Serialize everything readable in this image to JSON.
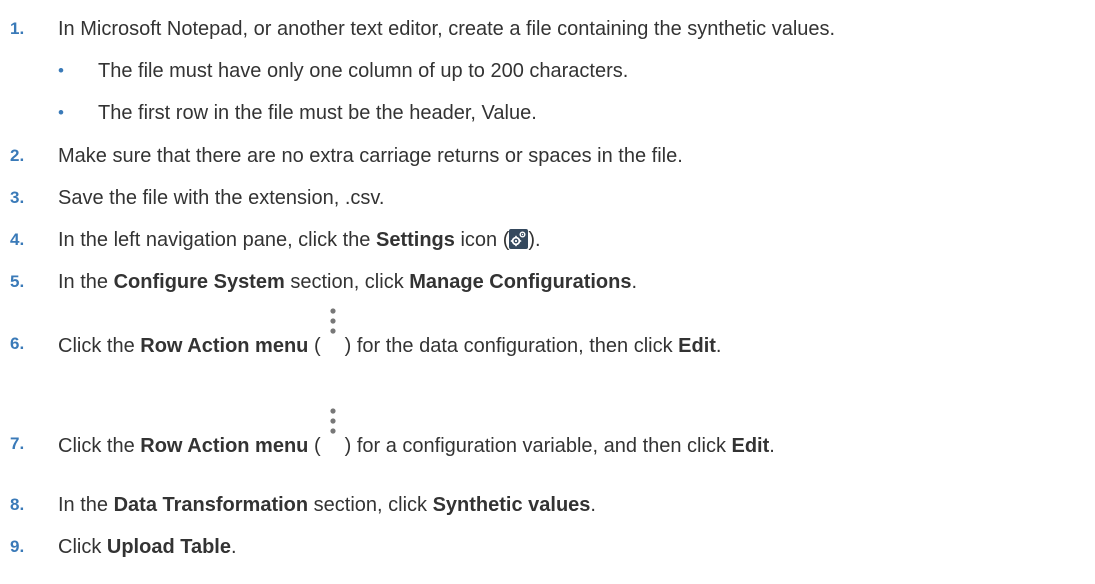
{
  "steps": [
    {
      "num": "1.",
      "text": "In Microsoft Notepad, or another text editor, create a file containing the synthetic values."
    },
    {
      "num": "2.",
      "text": "Make sure that there are no extra carriage returns or spaces in the file."
    },
    {
      "num": "3.",
      "text": "Save the file with the extension, .csv."
    },
    {
      "num": "4.",
      "pre": "In the left navigation pane, click the ",
      "bold1": "Settings",
      "mid": " icon (",
      "post": ")."
    },
    {
      "num": "5.",
      "pre": "In the ",
      "bold1": "Configure System",
      "mid": " section, click ",
      "bold2": "Manage Configurations",
      "post": "."
    },
    {
      "num": "6.",
      "pre": "Click the ",
      "bold1": "Row Action menu",
      "mid": " (",
      "mid2": ") for the data configuration, then click ",
      "bold2": "Edit",
      "post": "."
    },
    {
      "num": "7.",
      "pre": "Click the ",
      "bold1": "Row Action menu",
      "mid": " (",
      "mid2": ") for a configuration variable, and then click ",
      "bold2": "Edit",
      "post": "."
    },
    {
      "num": "8.",
      "pre": "In the ",
      "bold1": "Data Transformation",
      "mid": " section, click ",
      "bold2": "Synthetic values",
      "post": "."
    },
    {
      "num": "9.",
      "pre": "Click ",
      "bold1": "Upload Table",
      "post": "."
    }
  ],
  "subitems": [
    {
      "bullet": "•",
      "text": "The file must have only one column of up to 200 characters."
    },
    {
      "bullet": "•",
      "text": "The first row in the file must be the header, Value."
    }
  ],
  "icons": {
    "settings": "settings-gear-icon",
    "row_action": "vertical-ellipsis-icon"
  }
}
